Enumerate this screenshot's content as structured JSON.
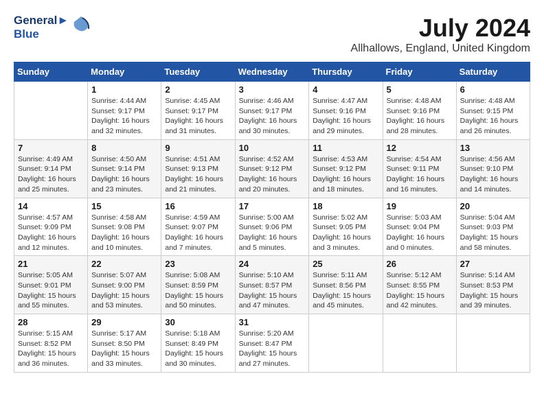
{
  "header": {
    "logo_line1": "General",
    "logo_line2": "Blue",
    "month_title": "July 2024",
    "location": "Allhallows, England, United Kingdom"
  },
  "columns": [
    "Sunday",
    "Monday",
    "Tuesday",
    "Wednesday",
    "Thursday",
    "Friday",
    "Saturday"
  ],
  "weeks": [
    [
      {
        "day": "",
        "sunrise": "",
        "sunset": "",
        "daylight": ""
      },
      {
        "day": "1",
        "sunrise": "Sunrise: 4:44 AM",
        "sunset": "Sunset: 9:17 PM",
        "daylight": "Daylight: 16 hours and 32 minutes."
      },
      {
        "day": "2",
        "sunrise": "Sunrise: 4:45 AM",
        "sunset": "Sunset: 9:17 PM",
        "daylight": "Daylight: 16 hours and 31 minutes."
      },
      {
        "day": "3",
        "sunrise": "Sunrise: 4:46 AM",
        "sunset": "Sunset: 9:17 PM",
        "daylight": "Daylight: 16 hours and 30 minutes."
      },
      {
        "day": "4",
        "sunrise": "Sunrise: 4:47 AM",
        "sunset": "Sunset: 9:16 PM",
        "daylight": "Daylight: 16 hours and 29 minutes."
      },
      {
        "day": "5",
        "sunrise": "Sunrise: 4:48 AM",
        "sunset": "Sunset: 9:16 PM",
        "daylight": "Daylight: 16 hours and 28 minutes."
      },
      {
        "day": "6",
        "sunrise": "Sunrise: 4:48 AM",
        "sunset": "Sunset: 9:15 PM",
        "daylight": "Daylight: 16 hours and 26 minutes."
      }
    ],
    [
      {
        "day": "7",
        "sunrise": "Sunrise: 4:49 AM",
        "sunset": "Sunset: 9:14 PM",
        "daylight": "Daylight: 16 hours and 25 minutes."
      },
      {
        "day": "8",
        "sunrise": "Sunrise: 4:50 AM",
        "sunset": "Sunset: 9:14 PM",
        "daylight": "Daylight: 16 hours and 23 minutes."
      },
      {
        "day": "9",
        "sunrise": "Sunrise: 4:51 AM",
        "sunset": "Sunset: 9:13 PM",
        "daylight": "Daylight: 16 hours and 21 minutes."
      },
      {
        "day": "10",
        "sunrise": "Sunrise: 4:52 AM",
        "sunset": "Sunset: 9:12 PM",
        "daylight": "Daylight: 16 hours and 20 minutes."
      },
      {
        "day": "11",
        "sunrise": "Sunrise: 4:53 AM",
        "sunset": "Sunset: 9:12 PM",
        "daylight": "Daylight: 16 hours and 18 minutes."
      },
      {
        "day": "12",
        "sunrise": "Sunrise: 4:54 AM",
        "sunset": "Sunset: 9:11 PM",
        "daylight": "Daylight: 16 hours and 16 minutes."
      },
      {
        "day": "13",
        "sunrise": "Sunrise: 4:56 AM",
        "sunset": "Sunset: 9:10 PM",
        "daylight": "Daylight: 16 hours and 14 minutes."
      }
    ],
    [
      {
        "day": "14",
        "sunrise": "Sunrise: 4:57 AM",
        "sunset": "Sunset: 9:09 PM",
        "daylight": "Daylight: 16 hours and 12 minutes."
      },
      {
        "day": "15",
        "sunrise": "Sunrise: 4:58 AM",
        "sunset": "Sunset: 9:08 PM",
        "daylight": "Daylight: 16 hours and 10 minutes."
      },
      {
        "day": "16",
        "sunrise": "Sunrise: 4:59 AM",
        "sunset": "Sunset: 9:07 PM",
        "daylight": "Daylight: 16 hours and 7 minutes."
      },
      {
        "day": "17",
        "sunrise": "Sunrise: 5:00 AM",
        "sunset": "Sunset: 9:06 PM",
        "daylight": "Daylight: 16 hours and 5 minutes."
      },
      {
        "day": "18",
        "sunrise": "Sunrise: 5:02 AM",
        "sunset": "Sunset: 9:05 PM",
        "daylight": "Daylight: 16 hours and 3 minutes."
      },
      {
        "day": "19",
        "sunrise": "Sunrise: 5:03 AM",
        "sunset": "Sunset: 9:04 PM",
        "daylight": "Daylight: 16 hours and 0 minutes."
      },
      {
        "day": "20",
        "sunrise": "Sunrise: 5:04 AM",
        "sunset": "Sunset: 9:03 PM",
        "daylight": "Daylight: 15 hours and 58 minutes."
      }
    ],
    [
      {
        "day": "21",
        "sunrise": "Sunrise: 5:05 AM",
        "sunset": "Sunset: 9:01 PM",
        "daylight": "Daylight: 15 hours and 55 minutes."
      },
      {
        "day": "22",
        "sunrise": "Sunrise: 5:07 AM",
        "sunset": "Sunset: 9:00 PM",
        "daylight": "Daylight: 15 hours and 53 minutes."
      },
      {
        "day": "23",
        "sunrise": "Sunrise: 5:08 AM",
        "sunset": "Sunset: 8:59 PM",
        "daylight": "Daylight: 15 hours and 50 minutes."
      },
      {
        "day": "24",
        "sunrise": "Sunrise: 5:10 AM",
        "sunset": "Sunset: 8:57 PM",
        "daylight": "Daylight: 15 hours and 47 minutes."
      },
      {
        "day": "25",
        "sunrise": "Sunrise: 5:11 AM",
        "sunset": "Sunset: 8:56 PM",
        "daylight": "Daylight: 15 hours and 45 minutes."
      },
      {
        "day": "26",
        "sunrise": "Sunrise: 5:12 AM",
        "sunset": "Sunset: 8:55 PM",
        "daylight": "Daylight: 15 hours and 42 minutes."
      },
      {
        "day": "27",
        "sunrise": "Sunrise: 5:14 AM",
        "sunset": "Sunset: 8:53 PM",
        "daylight": "Daylight: 15 hours and 39 minutes."
      }
    ],
    [
      {
        "day": "28",
        "sunrise": "Sunrise: 5:15 AM",
        "sunset": "Sunset: 8:52 PM",
        "daylight": "Daylight: 15 hours and 36 minutes."
      },
      {
        "day": "29",
        "sunrise": "Sunrise: 5:17 AM",
        "sunset": "Sunset: 8:50 PM",
        "daylight": "Daylight: 15 hours and 33 minutes."
      },
      {
        "day": "30",
        "sunrise": "Sunrise: 5:18 AM",
        "sunset": "Sunset: 8:49 PM",
        "daylight": "Daylight: 15 hours and 30 minutes."
      },
      {
        "day": "31",
        "sunrise": "Sunrise: 5:20 AM",
        "sunset": "Sunset: 8:47 PM",
        "daylight": "Daylight: 15 hours and 27 minutes."
      },
      {
        "day": "",
        "sunrise": "",
        "sunset": "",
        "daylight": ""
      },
      {
        "day": "",
        "sunrise": "",
        "sunset": "",
        "daylight": ""
      },
      {
        "day": "",
        "sunrise": "",
        "sunset": "",
        "daylight": ""
      }
    ]
  ]
}
